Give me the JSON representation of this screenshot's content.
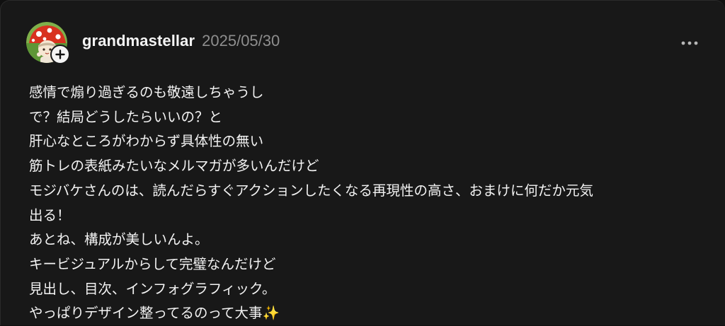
{
  "post": {
    "author": {
      "username": "grandmastellar",
      "avatar_icon": "mushroom-character-avatar",
      "follow_icon": "plus-icon"
    },
    "timestamp": "2025/05/30",
    "menu_icon": "more-horizontal-icon",
    "lines": [
      "感情で煽り過ぎるのも敬遠しちゃうし",
      "で？結局どうしたらいいの？と",
      "肝心なところがわからず具体性の無い",
      "筋トレの表紙みたいなメルマガが多いんだけど",
      "モジバケさんのは、読んだらすぐアクションしたくなる再現性の高さ、おまけに何だか元気",
      "出る！",
      "あとね、構成が美しいんよ。",
      "キービジュアルからして完璧なんだけど",
      "見出し、目次、インフォグラフィック。",
      "やっぱりデザイン整ってるのって大事✨"
    ]
  },
  "colors": {
    "background": "#181818",
    "text_primary": "#f3f3f3",
    "text_secondary": "#8e8e8e",
    "badge_background": "#f4f4f4"
  }
}
